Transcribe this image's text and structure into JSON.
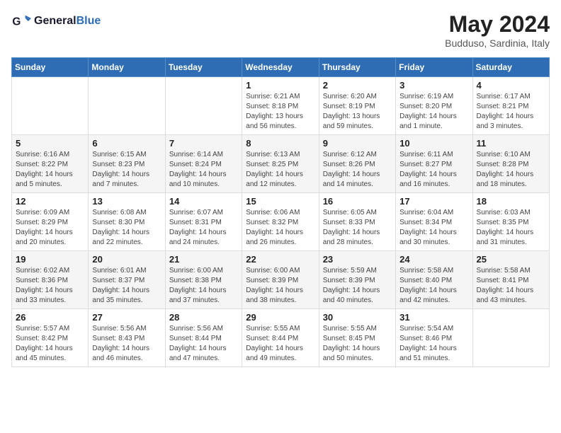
{
  "header": {
    "logo_general": "General",
    "logo_blue": "Blue",
    "month_title": "May 2024",
    "subtitle": "Budduso, Sardinia, Italy"
  },
  "days_of_week": [
    "Sunday",
    "Monday",
    "Tuesday",
    "Wednesday",
    "Thursday",
    "Friday",
    "Saturday"
  ],
  "weeks": [
    [
      {
        "day": "",
        "info": ""
      },
      {
        "day": "",
        "info": ""
      },
      {
        "day": "",
        "info": ""
      },
      {
        "day": "1",
        "info": "Sunrise: 6:21 AM\nSunset: 8:18 PM\nDaylight: 13 hours\nand 56 minutes."
      },
      {
        "day": "2",
        "info": "Sunrise: 6:20 AM\nSunset: 8:19 PM\nDaylight: 13 hours\nand 59 minutes."
      },
      {
        "day": "3",
        "info": "Sunrise: 6:19 AM\nSunset: 8:20 PM\nDaylight: 14 hours\nand 1 minute."
      },
      {
        "day": "4",
        "info": "Sunrise: 6:17 AM\nSunset: 8:21 PM\nDaylight: 14 hours\nand 3 minutes."
      }
    ],
    [
      {
        "day": "5",
        "info": "Sunrise: 6:16 AM\nSunset: 8:22 PM\nDaylight: 14 hours\nand 5 minutes."
      },
      {
        "day": "6",
        "info": "Sunrise: 6:15 AM\nSunset: 8:23 PM\nDaylight: 14 hours\nand 7 minutes."
      },
      {
        "day": "7",
        "info": "Sunrise: 6:14 AM\nSunset: 8:24 PM\nDaylight: 14 hours\nand 10 minutes."
      },
      {
        "day": "8",
        "info": "Sunrise: 6:13 AM\nSunset: 8:25 PM\nDaylight: 14 hours\nand 12 minutes."
      },
      {
        "day": "9",
        "info": "Sunrise: 6:12 AM\nSunset: 8:26 PM\nDaylight: 14 hours\nand 14 minutes."
      },
      {
        "day": "10",
        "info": "Sunrise: 6:11 AM\nSunset: 8:27 PM\nDaylight: 14 hours\nand 16 minutes."
      },
      {
        "day": "11",
        "info": "Sunrise: 6:10 AM\nSunset: 8:28 PM\nDaylight: 14 hours\nand 18 minutes."
      }
    ],
    [
      {
        "day": "12",
        "info": "Sunrise: 6:09 AM\nSunset: 8:29 PM\nDaylight: 14 hours\nand 20 minutes."
      },
      {
        "day": "13",
        "info": "Sunrise: 6:08 AM\nSunset: 8:30 PM\nDaylight: 14 hours\nand 22 minutes."
      },
      {
        "day": "14",
        "info": "Sunrise: 6:07 AM\nSunset: 8:31 PM\nDaylight: 14 hours\nand 24 minutes."
      },
      {
        "day": "15",
        "info": "Sunrise: 6:06 AM\nSunset: 8:32 PM\nDaylight: 14 hours\nand 26 minutes."
      },
      {
        "day": "16",
        "info": "Sunrise: 6:05 AM\nSunset: 8:33 PM\nDaylight: 14 hours\nand 28 minutes."
      },
      {
        "day": "17",
        "info": "Sunrise: 6:04 AM\nSunset: 8:34 PM\nDaylight: 14 hours\nand 30 minutes."
      },
      {
        "day": "18",
        "info": "Sunrise: 6:03 AM\nSunset: 8:35 PM\nDaylight: 14 hours\nand 31 minutes."
      }
    ],
    [
      {
        "day": "19",
        "info": "Sunrise: 6:02 AM\nSunset: 8:36 PM\nDaylight: 14 hours\nand 33 minutes."
      },
      {
        "day": "20",
        "info": "Sunrise: 6:01 AM\nSunset: 8:37 PM\nDaylight: 14 hours\nand 35 minutes."
      },
      {
        "day": "21",
        "info": "Sunrise: 6:00 AM\nSunset: 8:38 PM\nDaylight: 14 hours\nand 37 minutes."
      },
      {
        "day": "22",
        "info": "Sunrise: 6:00 AM\nSunset: 8:39 PM\nDaylight: 14 hours\nand 38 minutes."
      },
      {
        "day": "23",
        "info": "Sunrise: 5:59 AM\nSunset: 8:39 PM\nDaylight: 14 hours\nand 40 minutes."
      },
      {
        "day": "24",
        "info": "Sunrise: 5:58 AM\nSunset: 8:40 PM\nDaylight: 14 hours\nand 42 minutes."
      },
      {
        "day": "25",
        "info": "Sunrise: 5:58 AM\nSunset: 8:41 PM\nDaylight: 14 hours\nand 43 minutes."
      }
    ],
    [
      {
        "day": "26",
        "info": "Sunrise: 5:57 AM\nSunset: 8:42 PM\nDaylight: 14 hours\nand 45 minutes."
      },
      {
        "day": "27",
        "info": "Sunrise: 5:56 AM\nSunset: 8:43 PM\nDaylight: 14 hours\nand 46 minutes."
      },
      {
        "day": "28",
        "info": "Sunrise: 5:56 AM\nSunset: 8:44 PM\nDaylight: 14 hours\nand 47 minutes."
      },
      {
        "day": "29",
        "info": "Sunrise: 5:55 AM\nSunset: 8:44 PM\nDaylight: 14 hours\nand 49 minutes."
      },
      {
        "day": "30",
        "info": "Sunrise: 5:55 AM\nSunset: 8:45 PM\nDaylight: 14 hours\nand 50 minutes."
      },
      {
        "day": "31",
        "info": "Sunrise: 5:54 AM\nSunset: 8:46 PM\nDaylight: 14 hours\nand 51 minutes."
      },
      {
        "day": "",
        "info": ""
      }
    ]
  ]
}
